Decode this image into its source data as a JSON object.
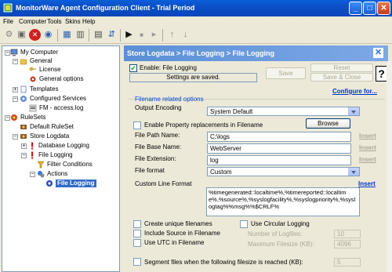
{
  "window": {
    "title": "MonitorWare Agent Configuration Client - Trial Period"
  },
  "menu": [
    "File",
    "Computer",
    "Tools",
    "Skins",
    "Help"
  ],
  "toolbar_icons": [
    "gear-icon",
    "save-icon",
    "stop-icon",
    "connect-icon",
    "tree-icon",
    "grid-icon",
    "document-icon",
    "export-icon",
    "play-icon",
    "stop-small-icon",
    "pause-play-icon",
    "up-arrow-icon",
    "down-arrow-icon"
  ],
  "tree": {
    "nodes": [
      {
        "label": "My Computer"
      },
      {
        "label": "General"
      },
      {
        "label": "License"
      },
      {
        "label": "General options"
      },
      {
        "label": "Templates"
      },
      {
        "label": "Configured Services"
      },
      {
        "label": "FM - access.log"
      },
      {
        "label": "RuleSets"
      },
      {
        "label": "Default RuleSet"
      },
      {
        "label": "Store Logdata"
      },
      {
        "label": "Database Logging"
      },
      {
        "label": "File Logging"
      },
      {
        "label": "Filter Conditions"
      },
      {
        "label": "Actions"
      },
      {
        "label": "File Logging"
      }
    ]
  },
  "panel": {
    "breadcrumb": "Store Logdata > File Logging > File Logging",
    "enable_label": "Enable: File Logging",
    "status": "Settings are saved.",
    "save": "Save",
    "reset": "Reset",
    "save_close": "Save & Close",
    "help": "?",
    "configure_for": "Configure for...",
    "group_label": "Filename related options",
    "output_encoding_label": "Output Encoding",
    "output_encoding_value": "System Default",
    "browse": "Browse",
    "property_replacements_label": "Enable Property replacements in Filename",
    "file_path_label": "File Path Name:",
    "file_path_value": "C:\\logs",
    "file_base_label": "File Base Name:",
    "file_base_value": "WebServer",
    "file_ext_label": "File Extension:",
    "file_ext_value": "log",
    "file_format_label": "File format",
    "file_format_value": "Custom",
    "insert": "Insert",
    "custom_line_label": "Custom Line Format",
    "custom_line_value": "%timegenerated::localtime%,%timereported::localtime%,%source%,%syslogfacility%,%syslogpriority%,%syslogtag%%msg%%$CRLF%",
    "unique_filenames": "Create unique filenames",
    "include_source": "Include Source in Filename",
    "use_utc": "Use UTC in Filename",
    "circular_logging": "Use Circular Logging",
    "num_logfiles_label": "Number of Logfiles:",
    "num_logfiles_value": "10",
    "max_filesize_label": "Maximum Filesize (KB):",
    "max_filesize_value": "4096",
    "segment_label": "Segment files when the following filesize is reached (KB):",
    "segment_value": "5"
  },
  "colors": {
    "title_bar": "#0a5fd8",
    "selection": "#316ac5",
    "link": "#0033cc"
  }
}
